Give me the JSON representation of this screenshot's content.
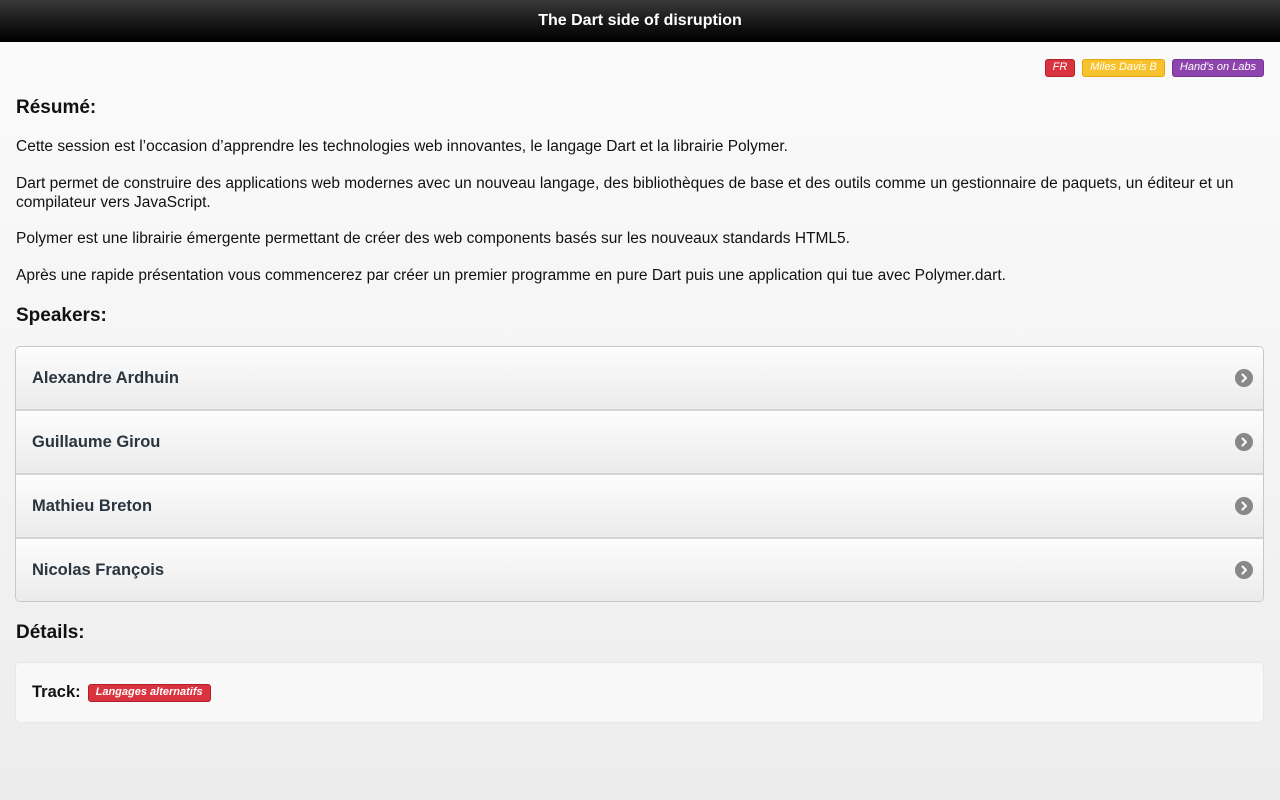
{
  "header": {
    "title": "The Dart side of disruption"
  },
  "badges": [
    {
      "label": "FR",
      "color": "#d9333f"
    },
    {
      "label": "Miles Davis B",
      "color": "#f7c22c"
    },
    {
      "label": "Hand's on Labs",
      "color": "#8e44ad"
    }
  ],
  "resume": {
    "heading": "Résumé:",
    "paragraphs": [
      "Cette session est l’occasion d’apprendre les technologies web innovantes, le langage Dart et la librairie Polymer.",
      "Dart permet de construire des applications web modernes avec un nouveau langage, des bibliothèques de base et des outils comme un gestionnaire de paquets, un éditeur et un compilateur vers JavaScript.",
      "Polymer est une librairie émergente permettant de créer des web components basés sur les nouveaux standards HTML5.",
      "Après une rapide présentation vous commencerez par créer un premier programme en pure Dart puis une application qui tue avec Polymer.dart."
    ]
  },
  "speakers": {
    "heading": "Speakers:",
    "items": [
      {
        "name": "Alexandre Ardhuin",
        "icon": "chevron-right-circle-icon"
      },
      {
        "name": "Guillaume Girou",
        "icon": "chevron-right-circle-icon"
      },
      {
        "name": "Mathieu Breton",
        "icon": "chevron-right-circle-icon"
      },
      {
        "name": "Nicolas François",
        "icon": "chevron-right-circle-icon"
      }
    ]
  },
  "details": {
    "heading": "Détails:",
    "track_label": "Track:",
    "track_value": "Langages alternatifs",
    "track_color": "#d9333f"
  }
}
